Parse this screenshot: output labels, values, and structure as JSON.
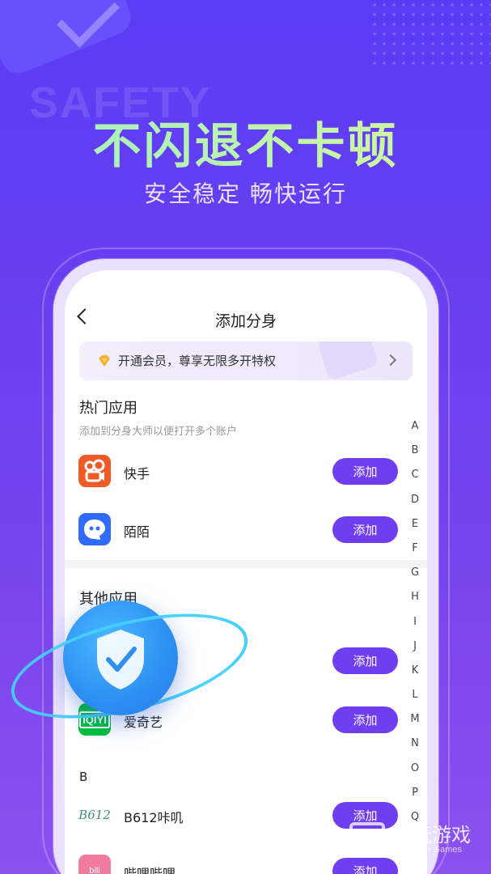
{
  "promo": {
    "bg_word": "SAFETY",
    "headline": "不闪退不卡顿",
    "subheadline": "安全稳定 畅快运行"
  },
  "screen": {
    "title": "添加分身",
    "vip_banner": "开通会员，尊享无限多开特权",
    "hot_section": {
      "title": "热门应用",
      "subtitle": "添加到分身大师以便打开多个账户",
      "apps": [
        {
          "name": "快手",
          "button": "添加",
          "icon": "kuaishou-icon",
          "color": "#f15a24"
        },
        {
          "name": "陌陌",
          "button": "添加",
          "icon": "momo-icon",
          "color": "#2f6bff"
        }
      ]
    },
    "other_section": {
      "title": "其他应用",
      "groups": [
        {
          "apps": [
            {
              "name": "",
              "button": "添加",
              "icon": "app-icon-hidden"
            },
            {
              "name": "爱奇艺",
              "button": "添加",
              "icon": "iqiyi-icon",
              "color": "#00c13a"
            }
          ]
        },
        {
          "letter": "B",
          "apps": [
            {
              "name": "B612咔叽",
              "button": "添加",
              "icon": "b612-icon"
            },
            {
              "name": "哔哩哔哩",
              "button": "添加",
              "icon": "bilibili-icon",
              "color": "#f07aa0"
            }
          ]
        }
      ]
    },
    "alphabet": [
      "A",
      "B",
      "C",
      "D",
      "E",
      "F",
      "G",
      "H",
      "I",
      "J",
      "K",
      "L",
      "M",
      "N",
      "O",
      "P",
      "Q"
    ]
  },
  "watermark": {
    "name": "仍玩游戏",
    "en": "Rengwan Games"
  },
  "colors": {
    "accent": "#6f3ef0",
    "background": "#5a3cf5"
  }
}
